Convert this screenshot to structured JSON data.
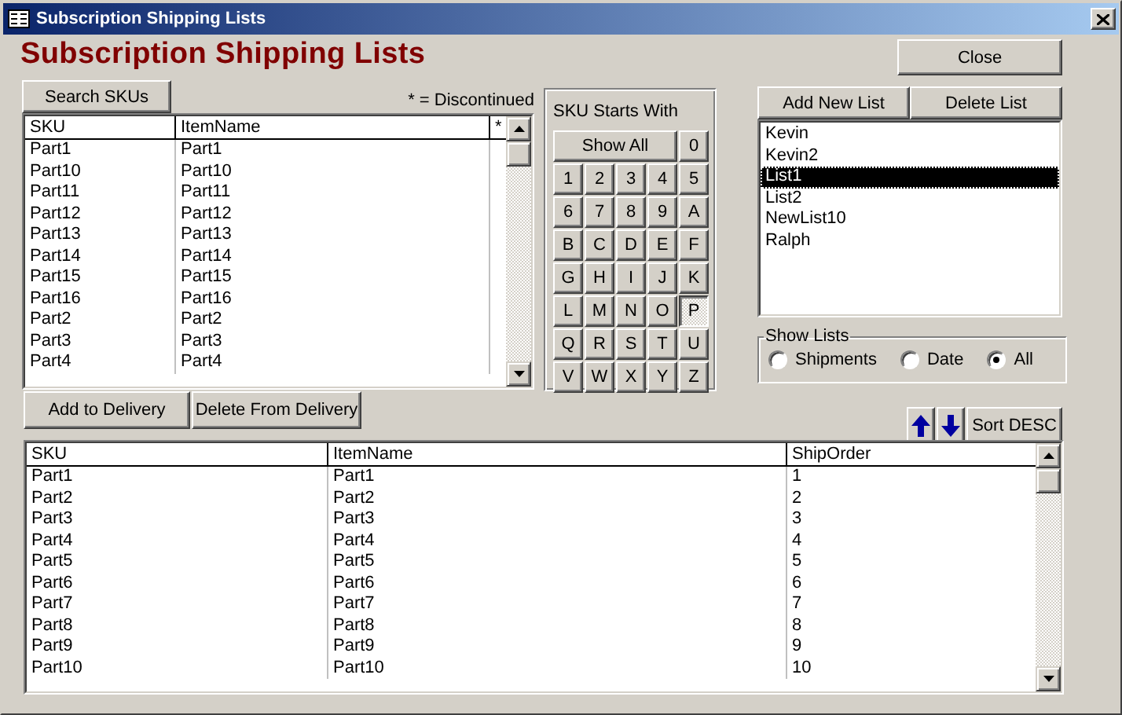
{
  "window": {
    "title": "Subscription Shipping Lists"
  },
  "heading": "Subscription Shipping Lists",
  "close_button": {
    "label": "Close"
  },
  "sku_search": {
    "button": {
      "label": "Search SKUs"
    },
    "note": "* = Discontinued",
    "columns": [
      "SKU",
      "ItemName",
      "*"
    ],
    "rows": [
      {
        "sku": "Part1",
        "item_name": "Part1"
      },
      {
        "sku": "Part10",
        "item_name": "Part10"
      },
      {
        "sku": "Part11",
        "item_name": "Part11"
      },
      {
        "sku": "Part12",
        "item_name": "Part12"
      },
      {
        "sku": "Part13",
        "item_name": "Part13"
      },
      {
        "sku": "Part14",
        "item_name": "Part14"
      },
      {
        "sku": "Part15",
        "item_name": "Part15"
      },
      {
        "sku": "Part16",
        "item_name": "Part16"
      },
      {
        "sku": "Part2",
        "item_name": "Part2"
      },
      {
        "sku": "Part3",
        "item_name": "Part3"
      },
      {
        "sku": "Part4",
        "item_name": "Part4"
      }
    ]
  },
  "sku_filter": {
    "title": "SKU Starts With",
    "keys": [
      {
        "label": "Show All",
        "selected": false
      },
      {
        "label": "0",
        "selected": false
      },
      {
        "label": "1",
        "selected": false
      },
      {
        "label": "2",
        "selected": false
      },
      {
        "label": "3",
        "selected": false
      },
      {
        "label": "4",
        "selected": false
      },
      {
        "label": "5",
        "selected": false
      },
      {
        "label": "6",
        "selected": false
      },
      {
        "label": "7",
        "selected": false
      },
      {
        "label": "8",
        "selected": false
      },
      {
        "label": "9",
        "selected": false
      },
      {
        "label": "A",
        "selected": false
      },
      {
        "label": "B",
        "selected": false
      },
      {
        "label": "C",
        "selected": false
      },
      {
        "label": "D",
        "selected": false
      },
      {
        "label": "E",
        "selected": false
      },
      {
        "label": "F",
        "selected": false
      },
      {
        "label": "G",
        "selected": false
      },
      {
        "label": "H",
        "selected": false
      },
      {
        "label": "I",
        "selected": false
      },
      {
        "label": "J",
        "selected": false
      },
      {
        "label": "K",
        "selected": false
      },
      {
        "label": "L",
        "selected": false
      },
      {
        "label": "M",
        "selected": false
      },
      {
        "label": "N",
        "selected": false
      },
      {
        "label": "O",
        "selected": false
      },
      {
        "label": "P",
        "selected": true
      },
      {
        "label": "Q",
        "selected": false
      },
      {
        "label": "R",
        "selected": false
      },
      {
        "label": "S",
        "selected": false
      },
      {
        "label": "T",
        "selected": false
      },
      {
        "label": "U",
        "selected": false
      },
      {
        "label": "V",
        "selected": false
      },
      {
        "label": "W",
        "selected": false
      },
      {
        "label": "X",
        "selected": false
      },
      {
        "label": "Y",
        "selected": false
      },
      {
        "label": "Z",
        "selected": false
      }
    ]
  },
  "lists": {
    "buttons": [
      {
        "label": "Add New List"
      },
      {
        "label": "Delete List"
      }
    ],
    "items": [
      {
        "label": "Kevin",
        "selected": false
      },
      {
        "label": "Kevin2",
        "selected": false
      },
      {
        "label": "List1",
        "selected": true
      },
      {
        "label": "List2",
        "selected": false
      },
      {
        "label": "NewList10",
        "selected": false
      },
      {
        "label": "Ralph",
        "selected": false
      }
    ],
    "show_lists": {
      "title": "Show Lists",
      "options": [
        {
          "label": "Shipments",
          "selected": false
        },
        {
          "label": "Date",
          "selected": false
        },
        {
          "label": "All",
          "selected": true
        }
      ]
    }
  },
  "delivery": {
    "buttons": [
      {
        "label": "Add to Delivery"
      },
      {
        "label": "Delete From Delivery"
      }
    ],
    "sort_button": {
      "label": "Sort DESC"
    },
    "columns": [
      "SKU",
      "ItemName",
      "ShipOrder"
    ],
    "rows": [
      {
        "sku": "Part1",
        "item_name": "Part1",
        "ship_order": "1"
      },
      {
        "sku": "Part2",
        "item_name": "Part2",
        "ship_order": "2"
      },
      {
        "sku": "Part3",
        "item_name": "Part3",
        "ship_order": "3"
      },
      {
        "sku": "Part4",
        "item_name": "Part4",
        "ship_order": "4"
      },
      {
        "sku": "Part5",
        "item_name": "Part5",
        "ship_order": "5"
      },
      {
        "sku": "Part6",
        "item_name": "Part6",
        "ship_order": "6"
      },
      {
        "sku": "Part7",
        "item_name": "Part7",
        "ship_order": "7"
      },
      {
        "sku": "Part8",
        "item_name": "Part8",
        "ship_order": "8"
      },
      {
        "sku": "Part9",
        "item_name": "Part9",
        "ship_order": "9"
      },
      {
        "sku": "Part10",
        "item_name": "Part10",
        "ship_order": "10"
      }
    ]
  }
}
